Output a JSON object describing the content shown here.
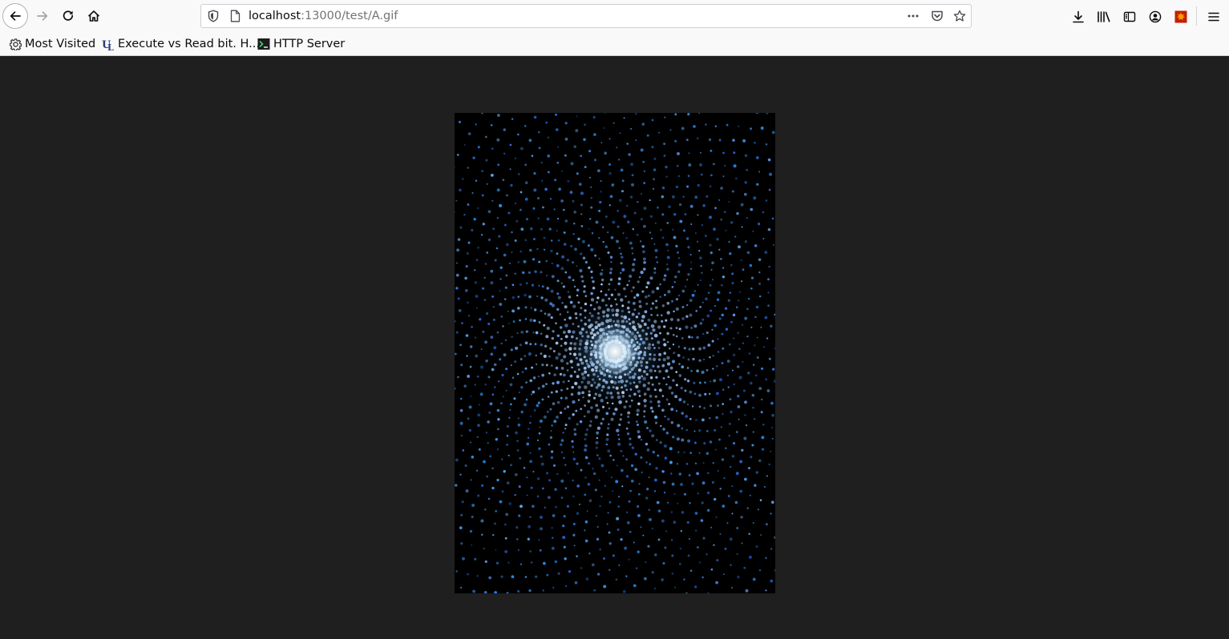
{
  "browser": {
    "url_host": "localhost",
    "url_rest": ":13000/test/A.gif",
    "bookmarks": [
      {
        "label": "Most Visited",
        "icon": "gear-icon"
      },
      {
        "label": "Execute vs Read bit. H...",
        "icon": "site-favicon"
      },
      {
        "label": "HTTP Server",
        "icon": "terminal-icon"
      }
    ],
    "toolbar_icons": [
      "back-icon",
      "forward-icon",
      "reload-icon",
      "home-icon",
      "shield-icon",
      "page-icon",
      "more-actions-icon",
      "pocket-icon",
      "star-icon",
      "download-icon",
      "library-icon",
      "sidebar-icon",
      "account-icon",
      "extension-icon",
      "hamburger-menu-icon"
    ]
  },
  "image": {
    "description_colors": {
      "background": "#000000",
      "glow_center": "#eaf6ff",
      "dots": "#4f8fd0"
    }
  }
}
